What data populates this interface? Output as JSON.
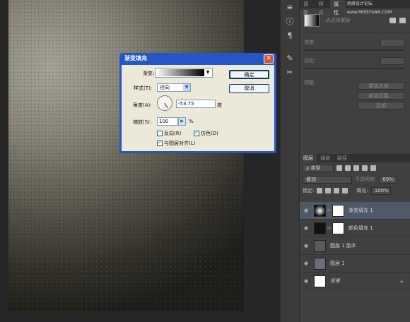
{
  "panel_tabs": [
    "调整",
    "样式",
    "属性"
  ],
  "watermark": "思缘设计论坛 www.MISSYUAN.COM",
  "properties": {
    "mask_title": "未选择蒙版",
    "density_label": "浓度:",
    "feather_label": "羽化:",
    "adjust_label": "调整:",
    "btn_mask_edge": "蒙版边缘...",
    "btn_color_range": "颜色范围...",
    "btn_invert": "反相"
  },
  "layers_panel": {
    "tabs": [
      "图层",
      "通道",
      "路径"
    ],
    "filter_type": "ρ 类型",
    "blend_mode": "叠加",
    "opacity_label": "不透明度:",
    "opacity_value": "69%",
    "lock_label": "锁定:",
    "fill_label": "填充:",
    "fill_value": "100%",
    "layers": [
      {
        "name": "渐变填充 1",
        "selected": true
      },
      {
        "name": "颜色填充 1",
        "selected": false
      },
      {
        "name": "图层 1 副本",
        "selected": false
      },
      {
        "name": "图层 1",
        "selected": false
      },
      {
        "name": "背景",
        "selected": false
      }
    ]
  },
  "dialog": {
    "title": "渐变填充",
    "gradient_label": "渐变:",
    "style_label": "样式(T):",
    "style_value": "径向",
    "angle_label": "角度(A):",
    "angle_value": "-53.75",
    "angle_unit": "度",
    "scale_label": "缩放(S):",
    "scale_value": "100",
    "scale_unit": "%",
    "reverse_label": "反向(R)",
    "reverse_checked": false,
    "dither_label": "仿色(D)",
    "dither_checked": true,
    "align_label": "与图层对齐(L)",
    "align_checked": true,
    "ok_label": "确定",
    "cancel_label": "取消"
  }
}
